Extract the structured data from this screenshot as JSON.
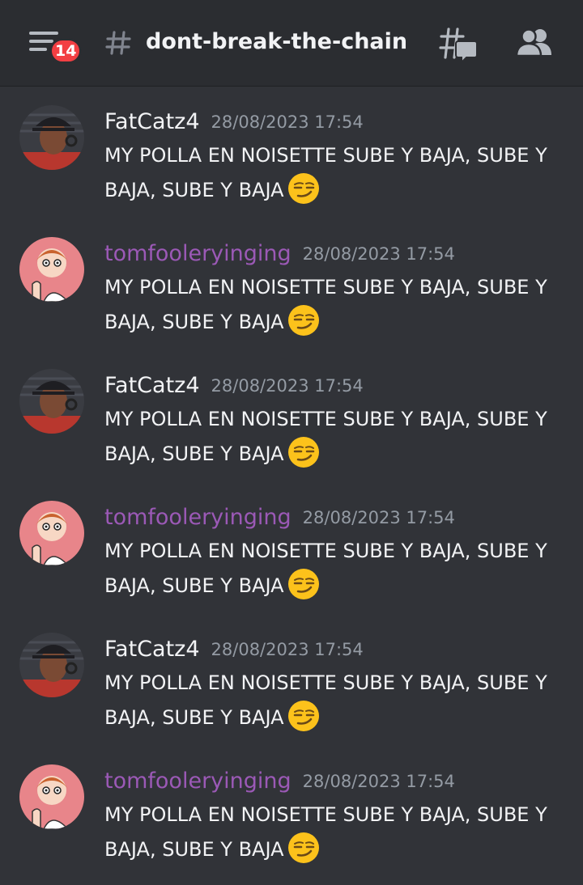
{
  "header": {
    "menu_icon": "hamburger-menu-icon",
    "unread_badge": "14",
    "channel_icon": "hash-icon",
    "channel_name": "dont-break-the-chain",
    "threads_icon": "threads-icon",
    "members_icon": "members-icon"
  },
  "colors": {
    "background": "#313338",
    "header_background": "#2b2d31",
    "badge": "#f23f43",
    "username_white": "#f2f3f5",
    "username_purple": "#9b59b6",
    "timestamp": "#949ba4"
  },
  "messages": [
    {
      "author": "FatCatz4",
      "timestamp": "28/08/2023 17:54",
      "text": "MY POLLA EN NOISETTE SUBE Y BAJA, SUBE Y BAJA, SUBE Y BAJA",
      "emoji": "smirking-face-emoji"
    },
    {
      "author": "tomfooleryinging",
      "timestamp": "28/08/2023 17:54",
      "text": "MY POLLA EN NOISETTE SUBE Y BAJA, SUBE Y BAJA, SUBE Y BAJA",
      "emoji": "smirking-face-emoji"
    },
    {
      "author": "FatCatz4",
      "timestamp": "28/08/2023 17:54",
      "text": "MY POLLA EN NOISETTE SUBE Y BAJA, SUBE Y BAJA, SUBE Y BAJA",
      "emoji": "smirking-face-emoji"
    },
    {
      "author": "tomfooleryinging",
      "timestamp": "28/08/2023 17:54",
      "text": "MY POLLA EN NOISETTE SUBE Y BAJA, SUBE Y BAJA, SUBE Y BAJA",
      "emoji": "smirking-face-emoji"
    },
    {
      "author": "FatCatz4",
      "timestamp": "28/08/2023 17:54",
      "text": "MY POLLA EN NOISETTE SUBE Y BAJA, SUBE Y BAJA, SUBE Y BAJA",
      "emoji": "smirking-face-emoji"
    },
    {
      "author": "tomfooleryinging",
      "timestamp": "28/08/2023 17:54",
      "text": "MY POLLA EN NOISETTE SUBE Y BAJA, SUBE Y BAJA, SUBE Y BAJA",
      "emoji": "smirking-face-emoji"
    }
  ]
}
